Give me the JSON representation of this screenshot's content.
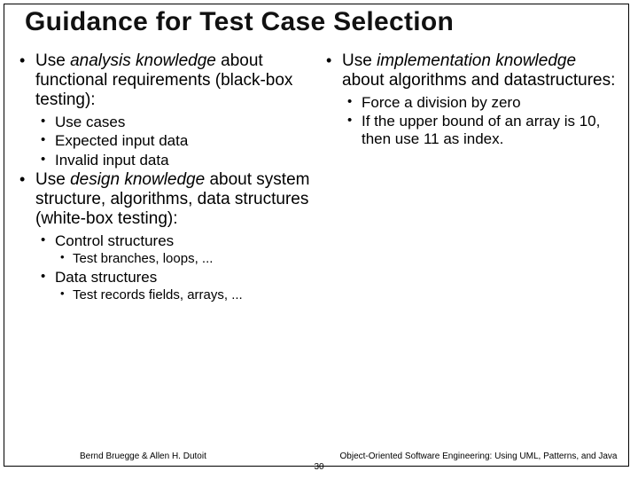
{
  "title": "Guidance for Test Case Selection",
  "left_col": {
    "b1": {
      "pre": "Use ",
      "em": "analysis knowledge",
      "post": " about functional requirements (black-box testing):",
      "subs": [
        "Use cases",
        "Expected input data",
        "Invalid input data"
      ]
    },
    "b2": {
      "pre": "Use ",
      "em": "design knowledge",
      "post": " about system structure, algorithms, data structures (white-box testing):",
      "subs": [
        {
          "text": "Control structures",
          "subsubs": [
            "Test branches, loops, ..."
          ]
        },
        {
          "text": "Data structures",
          "subsubs": [
            "Test records fields, arrays, ..."
          ]
        }
      ]
    }
  },
  "right_col": {
    "b1": {
      "pre": "Use ",
      "em": "implementation knowledge",
      "post": " about algorithms and datastructures:",
      "subs": [
        "Force a division by zero",
        "If the upper bound of an array is 10, then use 11 as index."
      ]
    }
  },
  "footer": {
    "left": "Bernd Bruegge & Allen H. Dutoit",
    "right": "Object-Oriented Software Engineering: Using UML, Patterns, and Java",
    "page": "30"
  }
}
